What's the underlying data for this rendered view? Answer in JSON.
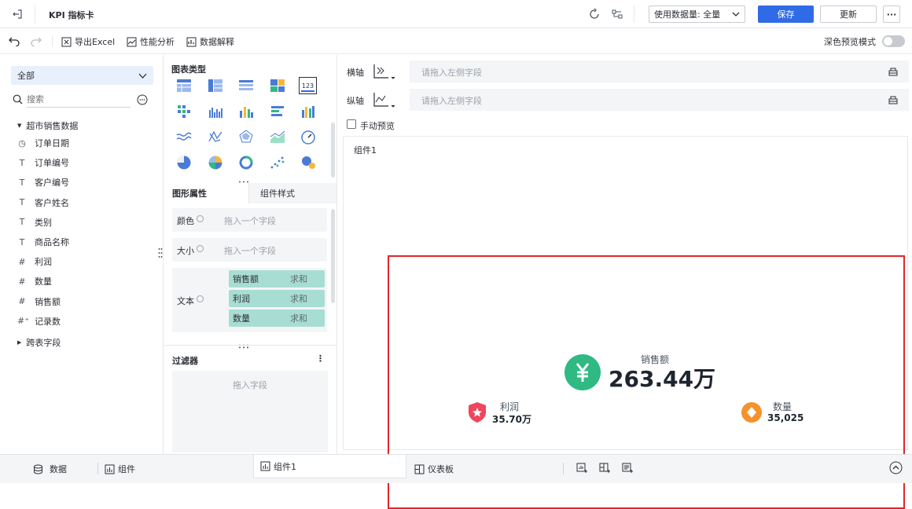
{
  "header": {
    "title": "KPI 指标卡",
    "data_amount_label": "使用数据量: 全量",
    "save_label": "保存",
    "update_label": "更新",
    "more_label": "···"
  },
  "toolbar": {
    "export_label": "导出Excel",
    "perf_label": "性能分析",
    "explain_label": "数据解释",
    "dark_preview_label": "深色预览模式"
  },
  "left": {
    "dataset_select": "全部",
    "search_placeholder": "搜索",
    "table_name": "超市销售数据",
    "fields": [
      {
        "label": "订单日期",
        "icon": "clock-icon"
      },
      {
        "label": "订单编号",
        "icon": "text-icon"
      },
      {
        "label": "客户编号",
        "icon": "text-icon"
      },
      {
        "label": "客户姓名",
        "icon": "text-icon"
      },
      {
        "label": "类别",
        "icon": "text-icon"
      },
      {
        "label": "商品名称",
        "icon": "text-icon"
      },
      {
        "label": "利润",
        "icon": "hash-icon"
      },
      {
        "label": "数量",
        "icon": "hash-icon"
      },
      {
        "label": "销售额",
        "icon": "hash-icon"
      },
      {
        "label": "记录数",
        "icon": "hash-plus-icon"
      }
    ],
    "cross_table": "跨表字段"
  },
  "middle": {
    "chart_type_title": "图表类型",
    "tab_graph_attrs": "图形属性",
    "tab_component_style": "组件样式",
    "color_label": "颜色",
    "color_placeholder": "拖入一个字段",
    "size_label": "大小",
    "size_placeholder": "拖入一个字段",
    "text_label": "文本",
    "text_pills": [
      {
        "name": "销售额",
        "agg": "求和"
      },
      {
        "name": "利润",
        "agg": "求和"
      },
      {
        "name": "数量",
        "agg": "求和"
      }
    ],
    "filter_title": "过滤器",
    "filter_placeholder": "拖入字段",
    "filter_more": "⋮"
  },
  "right": {
    "x_axis_label": "横轴",
    "x_axis_placeholder": "请拖入左侧字段",
    "y_axis_label": "纵轴",
    "y_axis_placeholder": "请拖入左侧字段",
    "manual_preview_label": "手动预览",
    "component_title": "组件1",
    "kpi_main": {
      "label": "销售额",
      "value": "263.44万",
      "symbol": "¥"
    },
    "kpi_sub": [
      {
        "label": "利润",
        "value": "35.70万"
      },
      {
        "label": "数量",
        "value": "35,025"
      }
    ]
  },
  "bottom": {
    "data_tab": "数据",
    "component_tab": "组件",
    "active_tab": "组件1",
    "dashboard_tab": "仪表板"
  },
  "colors": {
    "accent": "#2f6be6",
    "pill": "#a8ddd3",
    "highlight": "#e0262a",
    "kpi_green": "#2fb983",
    "kpi_red": "#f0455a",
    "kpi_orange": "#f5922b"
  }
}
